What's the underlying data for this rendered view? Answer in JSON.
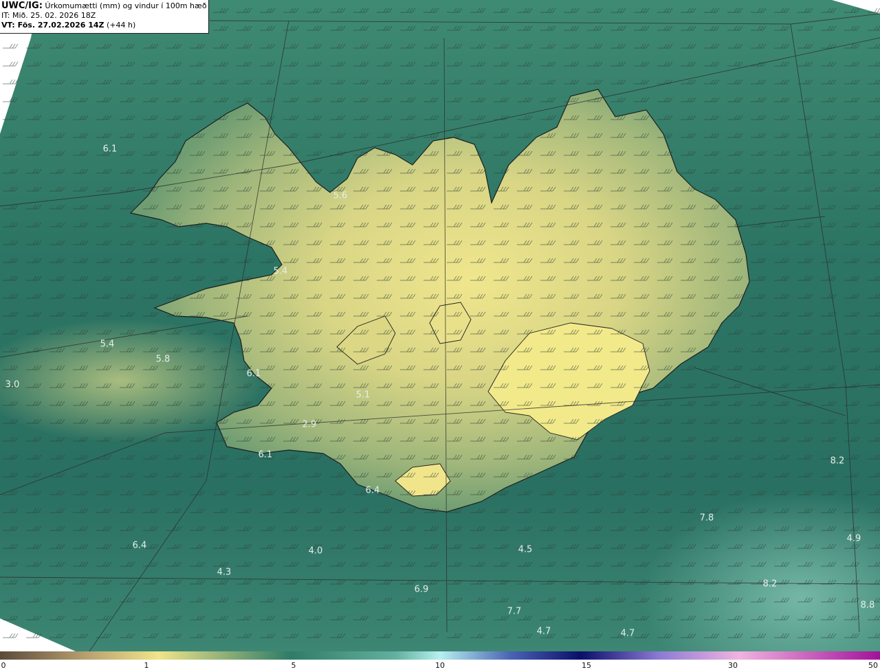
{
  "header": {
    "model": "UWC/IG:",
    "title": "Úrkomumætti (mm) og vindur í 100m hæð",
    "init_time": "IT: Mið. 25. 02. 2026 18Z",
    "valid_prefix": "VT: Fös. 27.02.2026 14Z",
    "valid_suffix": "(+44 h)"
  },
  "colors": {
    "sea_dark": "#1f5f56",
    "sea_mid": "#3d8670",
    "land_mid": "#9fb67b",
    "land_light": "#ece38b",
    "coastline": "#1d1d1d",
    "label": "#e6efe9"
  },
  "point_values": [
    {
      "text": "6.1"
    },
    {
      "text": "5.6"
    },
    {
      "text": "5.4"
    },
    {
      "text": "5.4"
    },
    {
      "text": "5.8"
    },
    {
      "text": "6.1"
    },
    {
      "text": "5.1"
    },
    {
      "text": "3.0"
    },
    {
      "text": "2.9"
    },
    {
      "text": "6.1"
    },
    {
      "text": "6.4"
    },
    {
      "text": "6.4"
    },
    {
      "text": "4.0"
    },
    {
      "text": "4.3"
    },
    {
      "text": "4.5"
    },
    {
      "text": "6.9"
    },
    {
      "text": "7.8"
    },
    {
      "text": "4.9"
    },
    {
      "text": "8.2"
    },
    {
      "text": "7.7"
    },
    {
      "text": "4.7"
    },
    {
      "text": "4.7"
    },
    {
      "text": "8.8"
    },
    {
      "text": "8.2"
    }
  ],
  "colorbar": {
    "ticks": [
      "0",
      "1",
      "5",
      "10",
      "15",
      "30",
      "50"
    ],
    "stops": [
      "#5b4a3a",
      "#b9a271",
      "#f1e48a",
      "#2f7c67",
      "#b7f0ef",
      "#233a8e",
      "#0a0f6a",
      "#8e7bd4",
      "#f0b3df",
      "#a1129a"
    ]
  }
}
